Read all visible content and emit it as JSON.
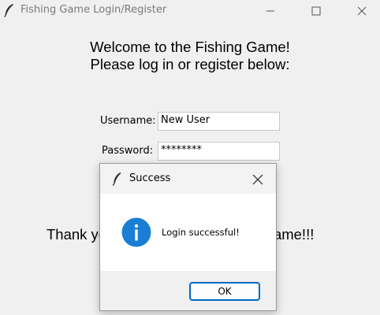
{
  "window": {
    "title": "Fishing Game Login/Register",
    "icon": "feather-icon"
  },
  "main": {
    "welcome_line1": "Welcome to the Fishing Game!",
    "welcome_line2": "Please log in or register below:",
    "username_label": "Username:",
    "username_value": "New User",
    "password_label": "Password:",
    "password_value": "********",
    "thanks_text": "Thank you for playing the Fishing game!!!"
  },
  "dialog": {
    "title": "Success",
    "icon": "info-icon",
    "message": "Login successful!",
    "ok_label": "OK",
    "accent_color": "#0067c0",
    "info_color": "#1a7fd4"
  }
}
